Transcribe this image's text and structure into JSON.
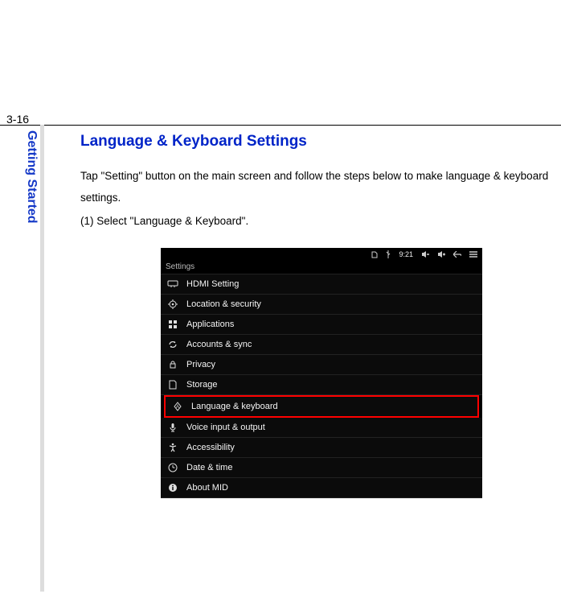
{
  "page_number": "3-16",
  "sidebar_label": "Getting Started",
  "section_title": "Language & Keyboard Settings",
  "paragraph_1": "Tap \"Setting\" button on the main screen and follow the steps below to make language & keyboard settings.",
  "paragraph_2": "(1) Select \"Language & Keyboard\".",
  "screenshot": {
    "status_time": "9:21",
    "header": "Settings",
    "items": [
      {
        "label": "HDMI Setting"
      },
      {
        "label": "Location & security"
      },
      {
        "label": "Applications"
      },
      {
        "label": "Accounts & sync"
      },
      {
        "label": "Privacy"
      },
      {
        "label": "Storage"
      },
      {
        "label": "Language & keyboard",
        "highlighted": true
      },
      {
        "label": "Voice input & output"
      },
      {
        "label": "Accessibility"
      },
      {
        "label": "Date & time"
      },
      {
        "label": "About MID"
      }
    ]
  }
}
